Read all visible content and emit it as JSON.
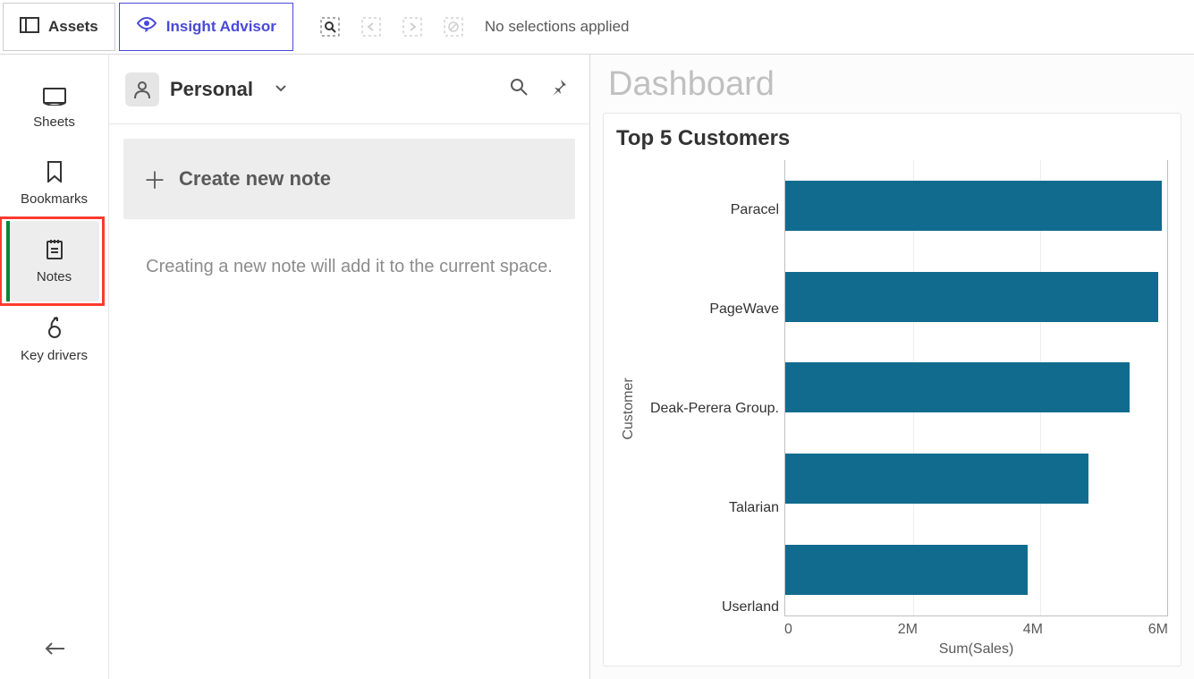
{
  "toolbar": {
    "assets_label": "Assets",
    "insight_label": "Insight Advisor",
    "no_selections": "No selections applied"
  },
  "sidebar": {
    "items": [
      {
        "label": "Sheets"
      },
      {
        "label": "Bookmarks"
      },
      {
        "label": "Notes"
      },
      {
        "label": "Key drivers"
      }
    ]
  },
  "notes_panel": {
    "scope_label": "Personal",
    "create_label": "Create new note",
    "empty_message": "Creating a new note will add it to the current space."
  },
  "dashboard": {
    "title": "Dashboard"
  },
  "chart_data": {
    "type": "bar",
    "orientation": "horizontal",
    "title": "Top 5 Customers",
    "ylabel": "Customer",
    "xlabel": "Sum(Sales)",
    "xticks": [
      "0",
      "2M",
      "4M",
      "6M"
    ],
    "xlim": [
      0,
      6000000
    ],
    "categories": [
      "Paracel",
      "PageWave",
      "Deak-Perera Group.",
      "Talarian",
      "Userland"
    ],
    "values": [
      5900000,
      5850000,
      5400000,
      4750000,
      3800000
    ]
  }
}
